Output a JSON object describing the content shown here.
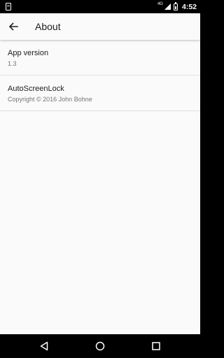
{
  "status_bar": {
    "network_label": "4G",
    "time": "4:52"
  },
  "app_bar": {
    "title": "About"
  },
  "items": [
    {
      "title": "App version",
      "subtitle": "1.3"
    },
    {
      "title": "AutoScreenLock",
      "subtitle": "Copyright © 2016 John Bohne"
    }
  ],
  "icons": {
    "back": "arrow-left-icon",
    "nav_back": "triangle-back-icon",
    "nav_home": "circle-home-icon",
    "nav_recents": "square-recents-icon"
  },
  "colors": {
    "background": "#fafafa",
    "divider": "#e0e0e0",
    "primary_text": "#212121",
    "secondary_text": "#757575"
  }
}
